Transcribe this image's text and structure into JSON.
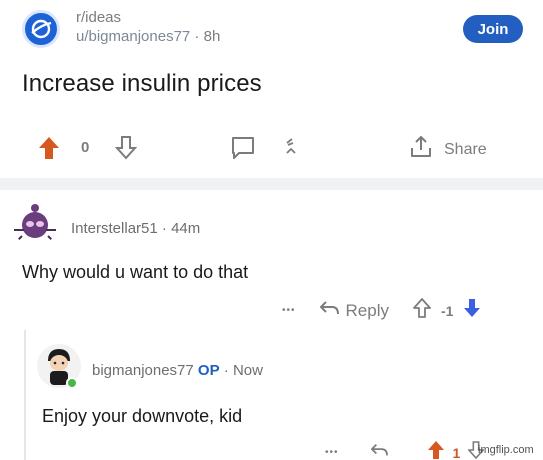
{
  "post": {
    "subreddit": "r/ideas",
    "user": "u/bigmanjones77",
    "time": "8h",
    "join_label": "Join",
    "title": "Increase insulin prices",
    "score": "0",
    "share_label": "Share"
  },
  "comment1": {
    "author": "Interstellar51",
    "time": "44m",
    "body": "Why would u want to do that",
    "dots": "•••",
    "reply_label": "Reply",
    "score": "-1"
  },
  "comment2": {
    "author": "bigmanjones77",
    "op_label": "OP",
    "time": "Now",
    "body": "Enjoy your downvote, kid",
    "dots": "•••",
    "score": "1"
  },
  "watermark": "imgflip.com",
  "colors": {
    "upvote": "#d4581f",
    "downvote": "#3b5fe0",
    "join": "#235fc1",
    "op": "#235fc1"
  },
  "icons": [
    "subreddit-icon",
    "upvote-icon",
    "downvote-icon",
    "comment-icon",
    "award-icon",
    "share-icon",
    "reply-icon",
    "more-icon",
    "online-dot-icon"
  ]
}
